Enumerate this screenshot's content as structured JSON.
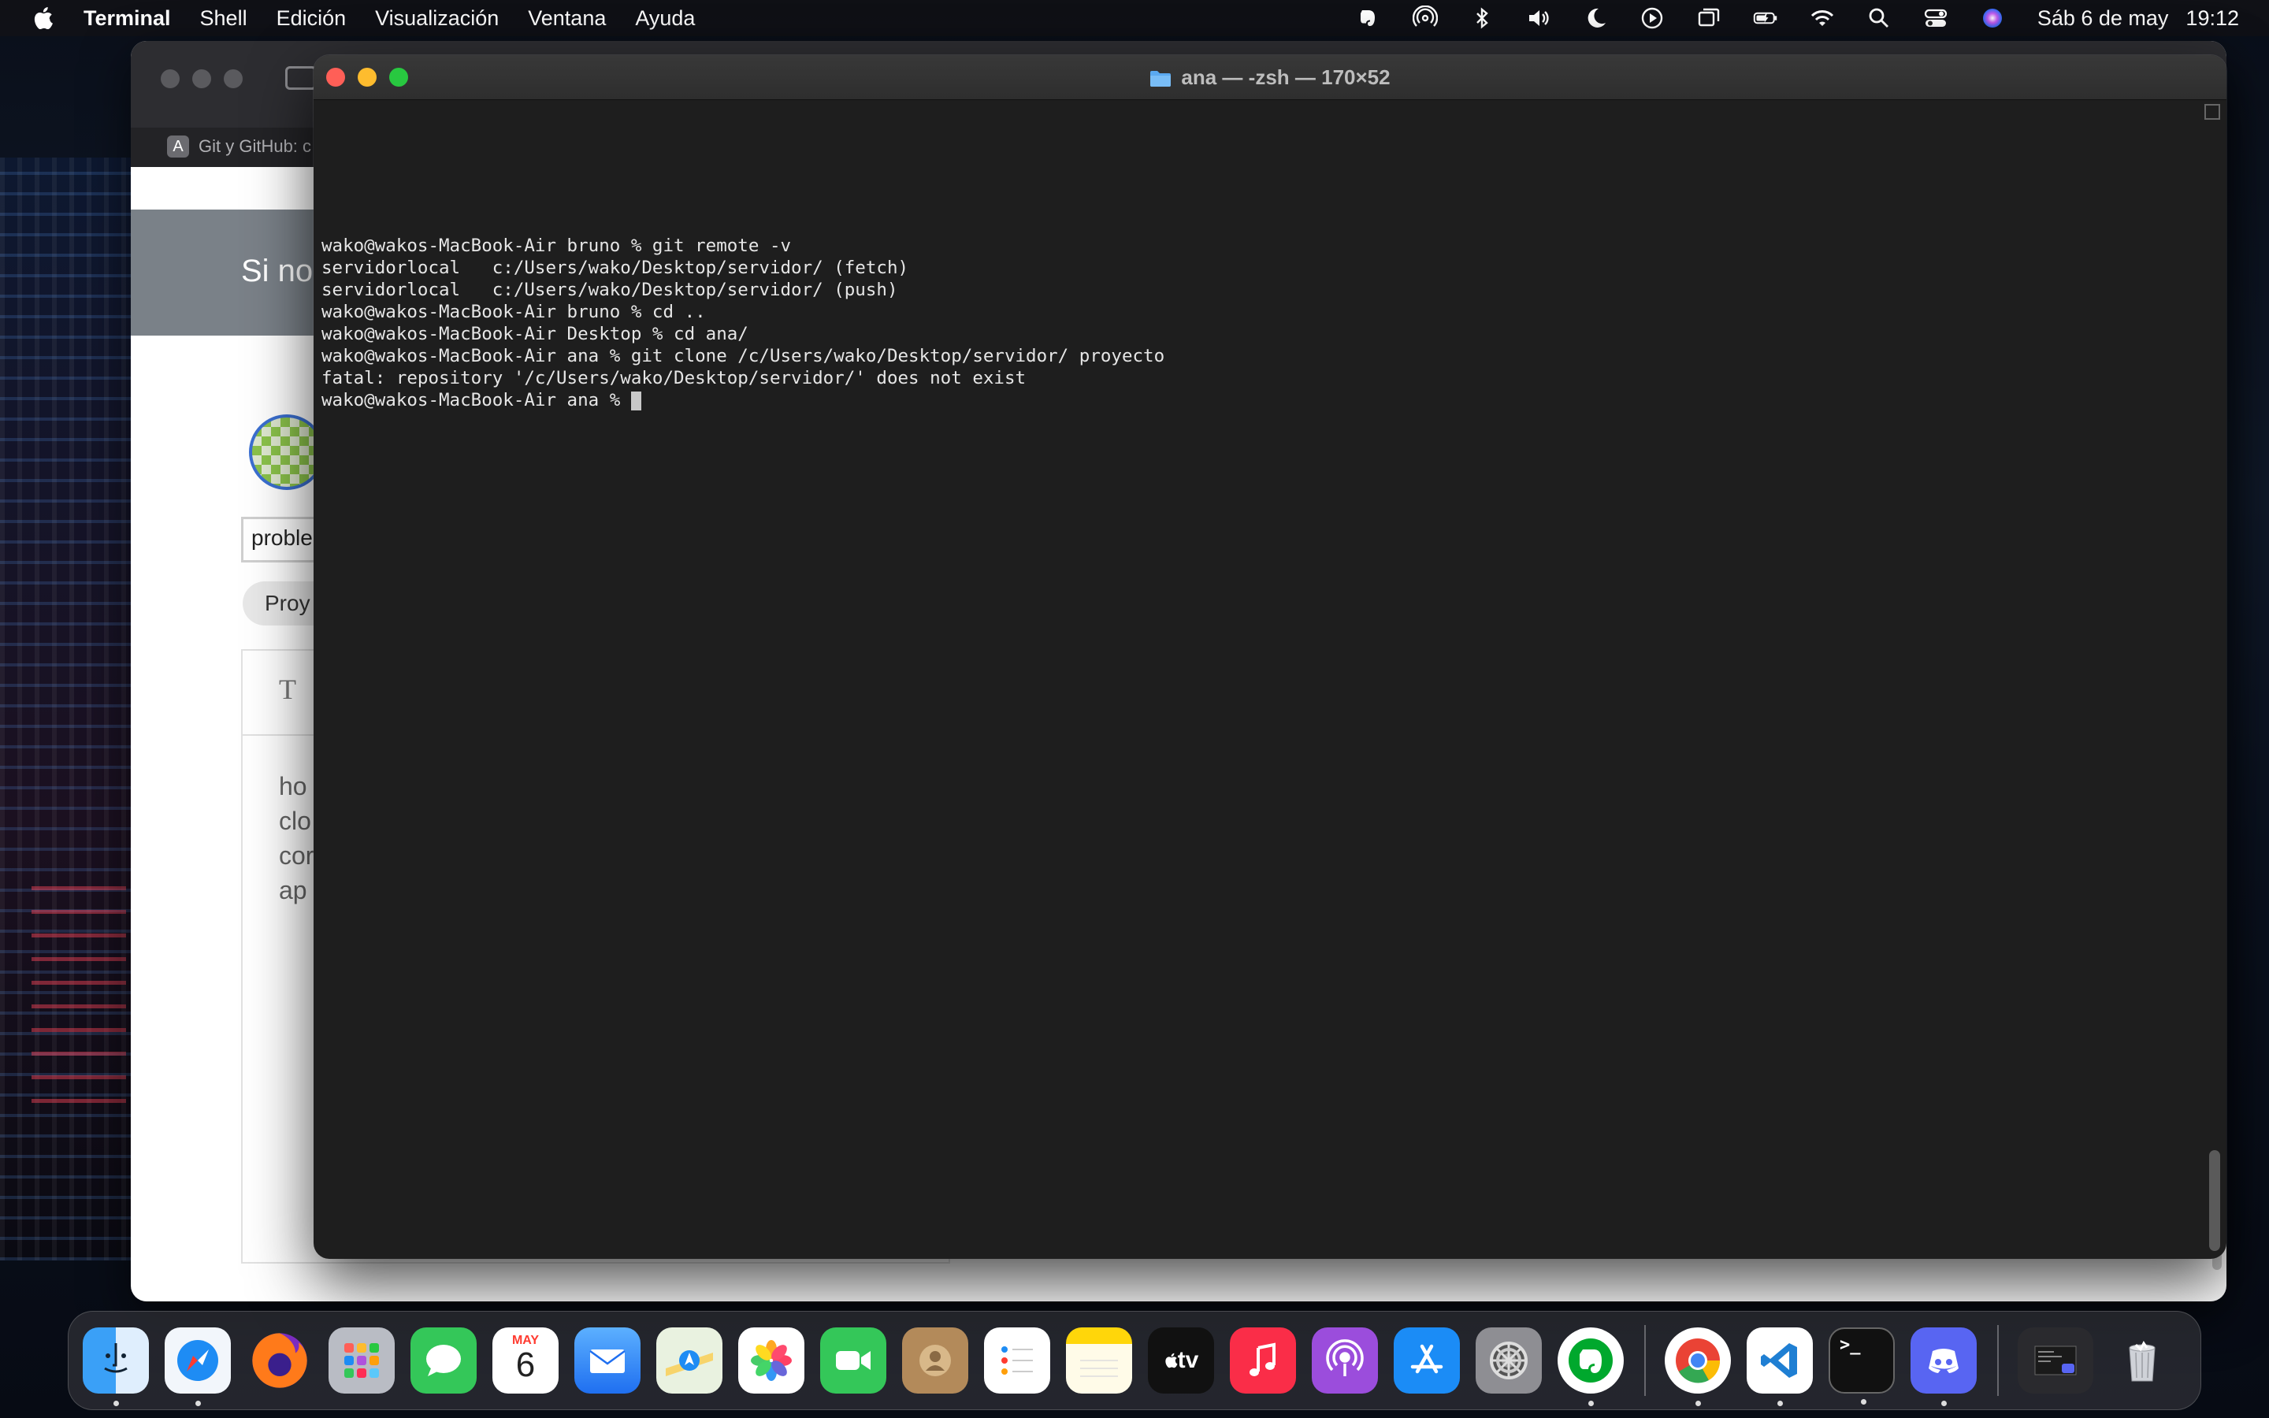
{
  "menubar": {
    "app_name": "Terminal",
    "items": [
      "Shell",
      "Edición",
      "Visualización",
      "Ventana",
      "Ayuda"
    ],
    "status_icons": [
      "evernote-icon",
      "airdrop-icon",
      "bluetooth-icon",
      "volume-icon",
      "moon-icon",
      "play-icon",
      "screen-mirroring-icon",
      "battery-icon",
      "wifi-icon",
      "spotlight-icon",
      "control-center-icon",
      "siri-icon"
    ],
    "date": "Sáb 6 de may",
    "time": "19:12"
  },
  "browser": {
    "tab_favicon": "A",
    "tab_title": "Git y GitHub: c",
    "band_text": "Si no",
    "input_value": "proble",
    "pill_label": "Proy",
    "editor_icon": "T",
    "paragraph": "ho\nclo\ncor\nap"
  },
  "terminal": {
    "title": "ana — -zsh — 170×52",
    "lines": [
      "wako@wakos-MacBook-Air bruno % git remote -v",
      "servidorlocal   c:/Users/wako/Desktop/servidor/ (fetch)",
      "servidorlocal   c:/Users/wako/Desktop/servidor/ (push)",
      "wako@wakos-MacBook-Air bruno % cd ..",
      "wako@wakos-MacBook-Air Desktop % cd ana/",
      "wako@wakos-MacBook-Air ana % git clone /c/Users/wako/Desktop/servidor/ proyecto",
      "fatal: repository '/c/Users/wako/Desktop/servidor/' does not exist"
    ],
    "prompt": "wako@wakos-MacBook-Air ana % "
  },
  "dock": {
    "calendar_month": "MAY",
    "calendar_day": "6",
    "tv_label": "tv",
    "colors": {
      "finder": "#2f8cf0",
      "safari": "#1e8cf4",
      "firefox": "#ff7a1a",
      "launchpad": "#8e8e93",
      "messages": "#34c759",
      "mail": "#2f7df5",
      "photos": "#ffffff",
      "facetime": "#34c759",
      "contacts": "#b38a5a",
      "music": "#fa2d48",
      "podcasts": "#9b4ddc",
      "appstore": "#1b8cf6",
      "settings": "#8e8e93",
      "evernote": "#00a82d",
      "vscode": "#1f7fd3",
      "discord": "#5865f2"
    }
  }
}
